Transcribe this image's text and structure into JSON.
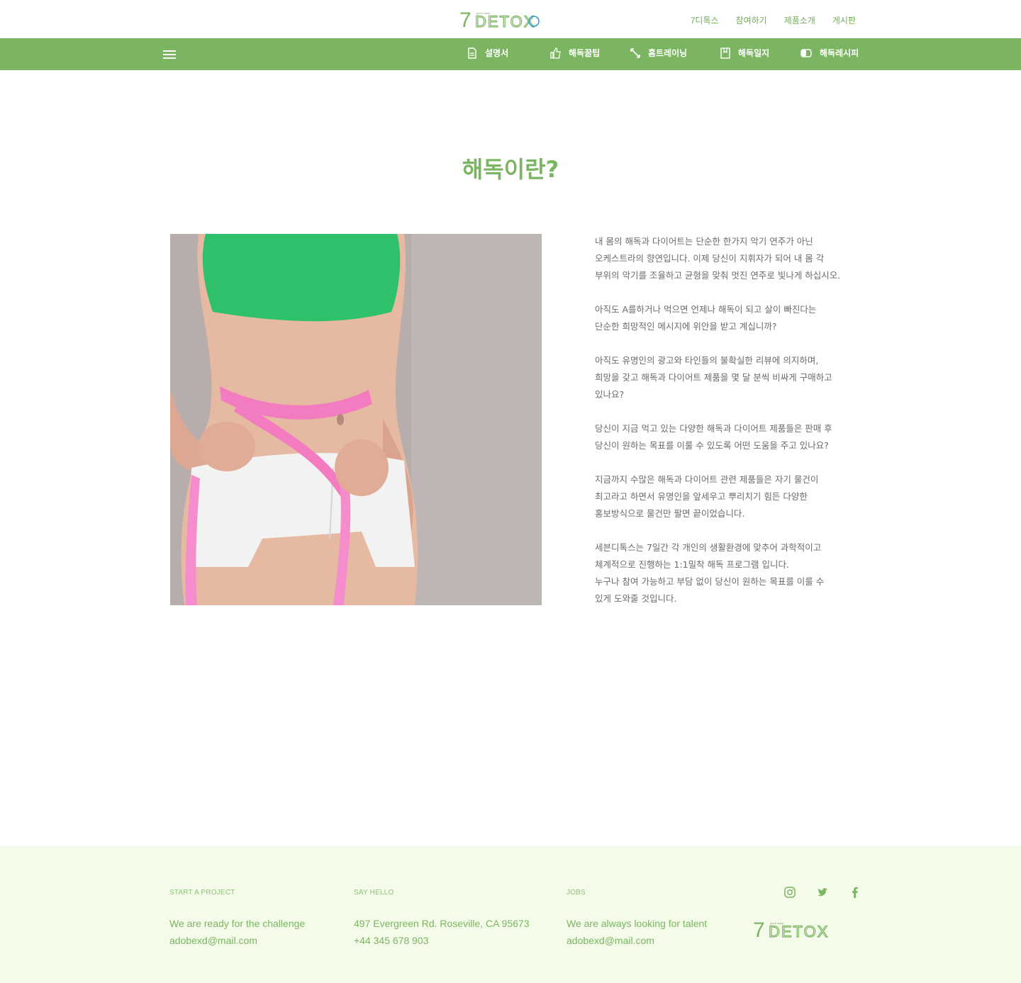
{
  "brand": {
    "logo_seven": "7",
    "logo_rest": "DETOX",
    "logo_tagline": "good sleep"
  },
  "top_nav": [
    "7디톡스",
    "참여하기",
    "제품소개",
    "게시판"
  ],
  "sub_nav": [
    {
      "label": "설명서",
      "icon": "document-icon"
    },
    {
      "label": "해독꿀팁",
      "icon": "thumbs-up-icon"
    },
    {
      "label": "홈트레이닝",
      "icon": "expand-arrows-icon"
    },
    {
      "label": "해독일지",
      "icon": "bookmark-icon"
    },
    {
      "label": "해독레시피",
      "icon": "toggle-icon"
    }
  ],
  "main": {
    "title": "해독이란?",
    "paragraphs": [
      "내 몸의 해독과 다이어트는 단순한 한가지 악기 연주가 아닌\n오케스트라의 향연입니다. 이제 당신이 지휘자가 되어 내 몸 각\n부위의 악기를 조율하고 균형을 맞춰 멋진 연주로 빛나게 하십시오.",
      "아직도 A를하거나 먹으면 언제나 해독이 되고 살이 빠진다는\n단순한  희망적인 메시지에 위안을 받고 계십니까?",
      "아직도 유명인의 광고와 타인들의 불확실한 리뷰에 의지하며,\n희망을 갖고 해독과 다이어트 제품을 몇 달 분씩 비싸게 구매하고\n있나요?",
      "당신이 지금 먹고 있는 다양한 해독과 다이어트 제품들은 판매 후\n당신이 원하는 목표를 이룰 수 있도록 어떤 도움을 주고 있나요?",
      "지금까지 수많은 해독과 다이어트 관련 제품들은 자기 물건이\n최고라고 하면서 유명인을 앞세우고 뿌리치기 힘든 다양한\n홍보방식으로 물건만 팔면 끝이었습니다.",
      "세븐디톡스는 7일간 각 개인의 생활환경에 맞추어 과학적이고\n체계적으로 진행하는 1:1밀착 해독 프로그램 입니다.\n누구나 참여 가능하고 부담 없이 당신이 원하는 목표를 이룰 수\n있게 도와줄 것입니다."
    ]
  },
  "footer": {
    "col1": {
      "heading": "START A PROJECT",
      "line1": "We are ready for the challenge",
      "line2": "adobexd@mail.com"
    },
    "col2": {
      "heading": "SAY HELLO",
      "line1": "497 Evergreen Rd. Roseville, CA 95673",
      "line2": "+44 345 678 903"
    },
    "col3": {
      "heading": "JOBS",
      "line1": "We are always looking for talent",
      "line2": "adobexd@mail.com"
    },
    "socials": [
      "instagram-icon",
      "twitter-icon",
      "facebook-icon"
    ]
  },
  "colors": {
    "accent": "#7cb562",
    "footer_bg": "#f4fbe9",
    "text": "#6b6b6b"
  }
}
